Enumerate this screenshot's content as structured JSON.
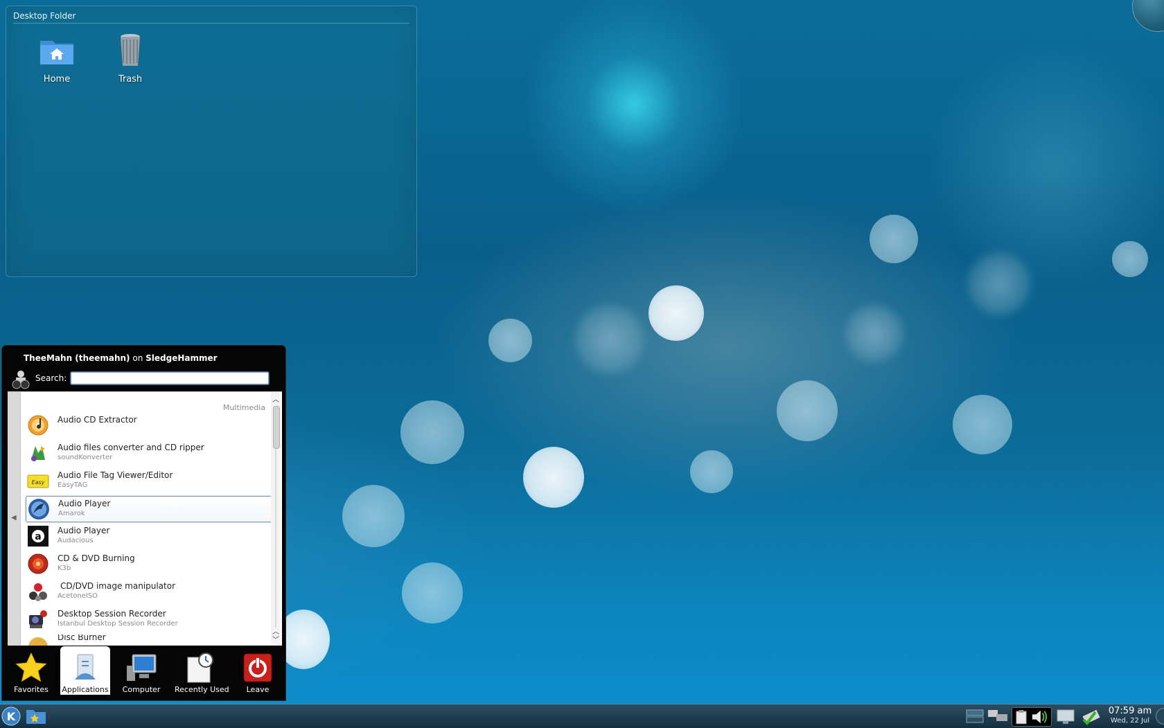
{
  "desktop_folder": {
    "title": "Desktop Folder",
    "icons": [
      {
        "label": "Home",
        "icon": "home-folder-icon"
      },
      {
        "label": "Trash",
        "icon": "trash-icon"
      }
    ]
  },
  "kickoff": {
    "user_name": "TheeMahn (theemahn)",
    "user_on": "on",
    "host": "SledgeHammer",
    "search_label": "Search:",
    "search_value": "",
    "category": "Multimedia",
    "items": [
      {
        "name": "Audio CD Extractor",
        "sub": "",
        "icon": "audio-cd-icon",
        "selected": false
      },
      {
        "name": "Audio files converter and CD ripper",
        "sub": "soundKonverter",
        "icon": "soundkonverter-icon",
        "selected": false
      },
      {
        "name": "Audio File Tag Viewer/Editor",
        "sub": "EasyTAG",
        "icon": "easytag-icon",
        "selected": false
      },
      {
        "name": "Audio Player",
        "sub": "Amarok",
        "icon": "amarok-icon",
        "selected": true
      },
      {
        "name": "Audio Player",
        "sub": "Audacious",
        "icon": "audacious-icon",
        "selected": false
      },
      {
        "name": "CD & DVD Burning",
        "sub": "K3b",
        "icon": "k3b-icon",
        "selected": false
      },
      {
        "name": "CD/DVD image manipulator",
        "sub": "AcetoneISO",
        "icon": "acetoneiso-icon",
        "selected": false
      },
      {
        "name": "Desktop Session Recorder",
        "sub": "Istanbul Desktop Session Recorder",
        "icon": "istanbul-icon",
        "selected": false
      },
      {
        "name": "Disc Burner",
        "sub": "",
        "icon": "disc-burner-icon",
        "selected": false
      }
    ],
    "tabs": [
      {
        "label": "Favorites",
        "icon": "star-icon",
        "active": false
      },
      {
        "label": "Applications",
        "icon": "applications-icon",
        "active": true
      },
      {
        "label": "Computer",
        "icon": "computer-icon",
        "active": false
      },
      {
        "label": "Recently Used",
        "icon": "recently-used-icon",
        "active": false
      },
      {
        "label": "Leave",
        "icon": "power-icon",
        "active": false
      }
    ]
  },
  "taskbar": {
    "clock_time": "07:59 am",
    "clock_date": "Wed, 22 Jul"
  },
  "colors": {
    "desktop_blue": "#0b6d9b",
    "panel_dark": "#050505",
    "selection_border": "#7c93b4"
  }
}
